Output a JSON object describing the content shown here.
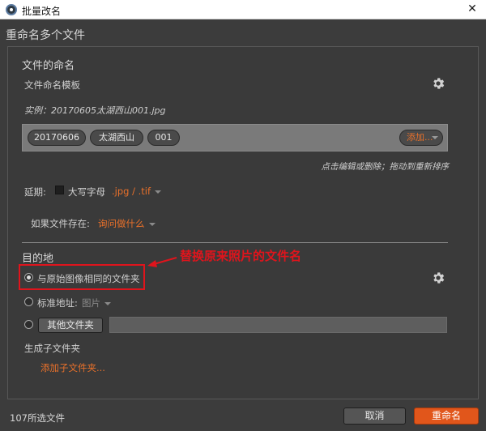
{
  "window": {
    "title": "批量改名",
    "close_glyph": "✕"
  },
  "dialog": {
    "header": "重命名多个文件"
  },
  "file_naming": {
    "section_title": "文件的命名",
    "template_label": "文件命名模板",
    "example": "实例：20170605太湖西山001.jpg",
    "tokens": [
      "20170606",
      "太湖西山",
      "001"
    ],
    "add_label": "添加...",
    "hint": "点击编辑或删除；拖动到重新排序",
    "ext_label": "延期:",
    "uppercase_label": "大写字母",
    "extension_value": ".jpg / .tif",
    "if_exists_label": "如果文件存在:",
    "if_exists_value": "询问做什么"
  },
  "destination": {
    "section_title": "目的地",
    "option_same_folder": "与原始图像相同的文件夹",
    "option_standard": "标准地址:",
    "standard_value": "图片",
    "other_folder_button": "其他文件夹",
    "other_folder_path": "",
    "subfolder_label": "生成子文件夹",
    "add_subfolder": "添加子文件夹..."
  },
  "annotation": {
    "text": "替换原来照片的文件名",
    "color": "#e0141c"
  },
  "footer": {
    "count": "107所选文件",
    "cancel_label": "取消",
    "rename_label": "重命名"
  },
  "colors": {
    "accent": "#e8702a",
    "primary_button": "#e1561b",
    "background": "#3c3c3c"
  },
  "icons": {
    "settings": "gear-icon",
    "arrow": "arrow-left-icon"
  }
}
